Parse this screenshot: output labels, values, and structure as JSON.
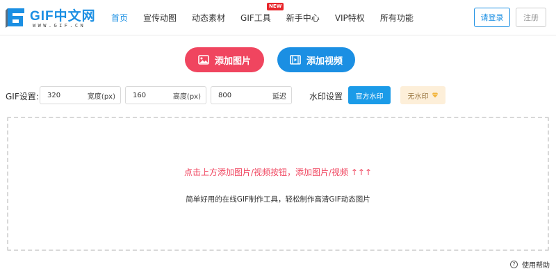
{
  "header": {
    "logo": {
      "title": "GIF中文网",
      "subtitle": "WWW.GIF.CN"
    },
    "nav": [
      {
        "label": "首页",
        "active": true
      },
      {
        "label": "宣传动图",
        "active": false
      },
      {
        "label": "动态素材",
        "active": false
      },
      {
        "label": "GIF工具",
        "active": false,
        "badge": "NEW"
      },
      {
        "label": "新手中心",
        "active": false
      },
      {
        "label": "VIP特权",
        "active": false
      },
      {
        "label": "所有功能",
        "active": false
      }
    ],
    "login_label": "请登录",
    "register_label": "注册"
  },
  "actions": {
    "add_image_label": "添加图片",
    "add_video_label": "添加视频"
  },
  "settings": {
    "label": "GIF设置:",
    "width": {
      "value": "320",
      "unit": "宽度(px)"
    },
    "height": {
      "value": "160",
      "unit": "高度(px)"
    },
    "delay": {
      "value": "800",
      "unit": "延迟"
    },
    "watermark_label": "水印设置",
    "official_watermark_label": "官方水印",
    "no_watermark_label": "无水印"
  },
  "dropzone": {
    "hint": "点击上方添加图片/视频按钮，添加图片/视频 ↑↑↑",
    "description": "简单好用的在线GIF制作工具，轻松制作高清GIF动态图片"
  },
  "help": {
    "label": "使用帮助",
    "icon": "question-icon"
  },
  "colors": {
    "brand_blue": "#1b8fe3",
    "accent_red": "#f0455f",
    "badge_red": "#e8252a",
    "gold_bg": "#fdefd9"
  }
}
